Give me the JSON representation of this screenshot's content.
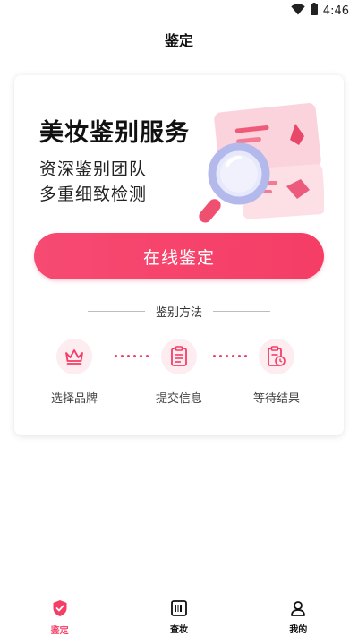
{
  "status_bar": {
    "time": "4:46",
    "wifi_icon": "wifi-icon",
    "battery_icon": "battery-icon"
  },
  "header": {
    "title": "鉴定"
  },
  "hero": {
    "title": "美妆鉴别服务",
    "subtitle_1": "资深鉴别团队",
    "subtitle_2": "多重细致检测"
  },
  "cta": {
    "label": "在线鉴定"
  },
  "method": {
    "title": "鉴别方法",
    "steps": [
      {
        "label": "选择品牌",
        "icon": "crown-icon"
      },
      {
        "label": "提交信息",
        "icon": "document-icon"
      },
      {
        "label": "等待结果",
        "icon": "clock-document-icon"
      }
    ]
  },
  "nav": {
    "items": [
      {
        "label": "鉴定",
        "icon": "shield-check-icon",
        "active": true
      },
      {
        "label": "查妆",
        "icon": "barcode-box-icon",
        "active": false
      },
      {
        "label": "我的",
        "icon": "user-icon",
        "active": false
      }
    ]
  },
  "colors": {
    "accent": "#F53D66",
    "accent_light": "#FDECF0",
    "text": "#111111"
  }
}
